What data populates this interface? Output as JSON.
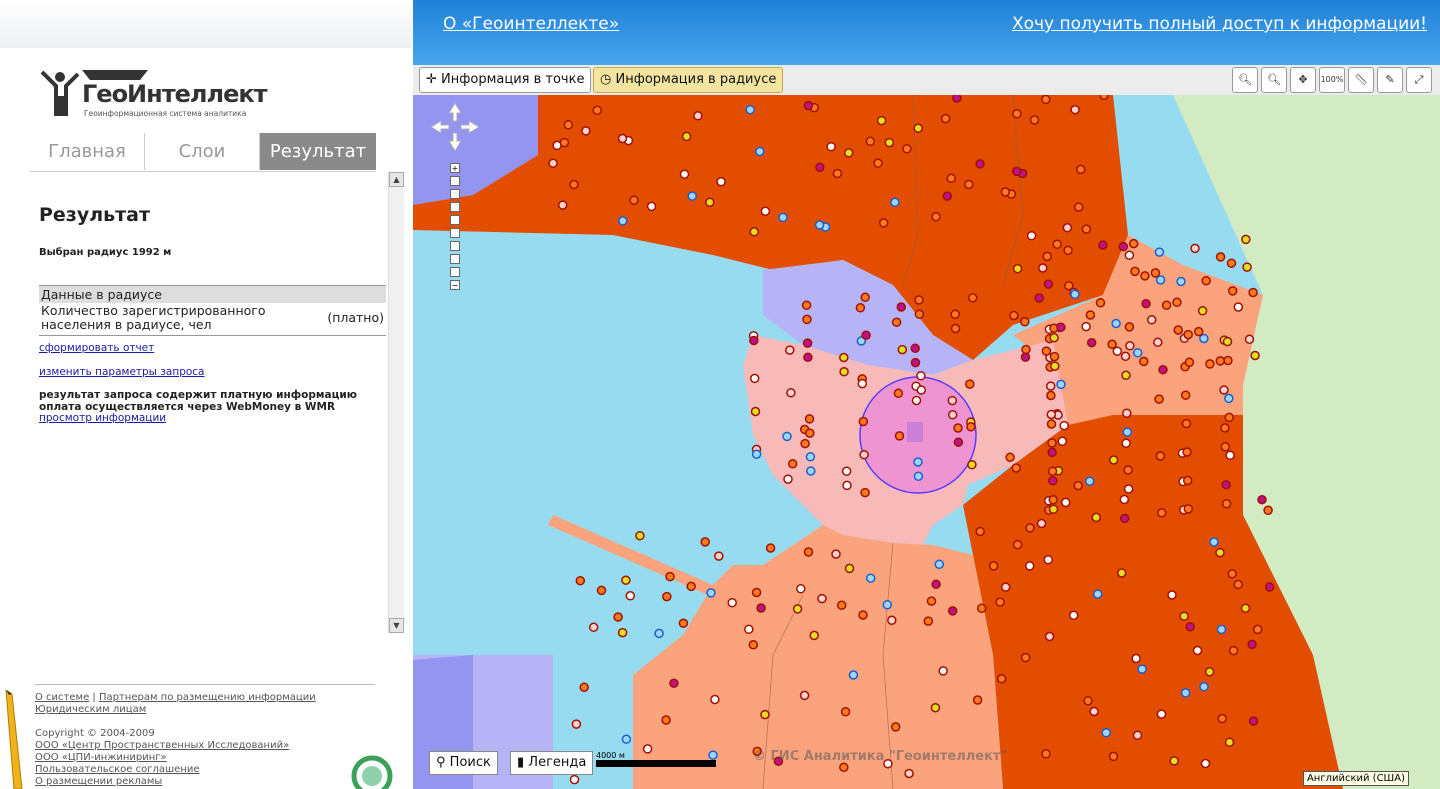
{
  "header": {
    "about_link": "О «Геоинтеллекте»",
    "access_link": "Хочу получить полный доступ к информации!"
  },
  "logo": {
    "name": "ГеоИнтеллект",
    "tagline": "Геоинформационная система аналитика"
  },
  "tabs": [
    {
      "label": "Главная",
      "active": false
    },
    {
      "label": "Слои",
      "active": false
    },
    {
      "label": "Результат",
      "active": true
    }
  ],
  "result": {
    "title": "Результат",
    "radius_text": "Выбран радиус 1992 м",
    "table_header": "Данные в радиусе",
    "row_label_1": "Количество зарегистрированного",
    "row_label_2": "населения в радиусе, чел",
    "row_value": "(платно)",
    "report_link": "сформировать отчет",
    "params_link": "изменить параметры запроса",
    "paid_line1": "результат запроса содержит платную информацию",
    "paid_line2": "оплата осуществляется через WebMoney в WMR",
    "view_link": "просмотр информации"
  },
  "footer": {
    "about": "О системе",
    "sep": "|",
    "partners": "Партнерам по размещению информации",
    "legal": "Юридическим лицам",
    "copyright": "Copyright © 2004-2009",
    "org1": "ООО «Центр Пространственных Исследований»",
    "org2": "ООО «ЦПИ-инжиниринг»",
    "agreement": "Пользовательское соглашение",
    "ads": "О размещении рекламы"
  },
  "toolbar": {
    "info_point": "Информация в точке",
    "info_radius": "Информация в радиусе",
    "zoom_100": "100%",
    "icons": [
      "zoom-in-icon",
      "zoom-out-icon",
      "pan-icon",
      "zoom-100-icon",
      "ruler-icon",
      "pencil-icon",
      "fullscreen-icon"
    ]
  },
  "map": {
    "search_btn": "Поиск",
    "legend_btn": "Легенда",
    "scale_label": "4000 м",
    "copyright": "© ГИС Аналитика \"Геоинтеллект\"",
    "language": "Английский (США)",
    "colors": {
      "water": "#97dbf0",
      "dark_orange": "#e24d00",
      "salmon": "#fba37d",
      "pink": "#f8b9b9",
      "lavender": "#b6b3f6",
      "green": "#d3ebc2",
      "purple": "#9495f0"
    }
  }
}
